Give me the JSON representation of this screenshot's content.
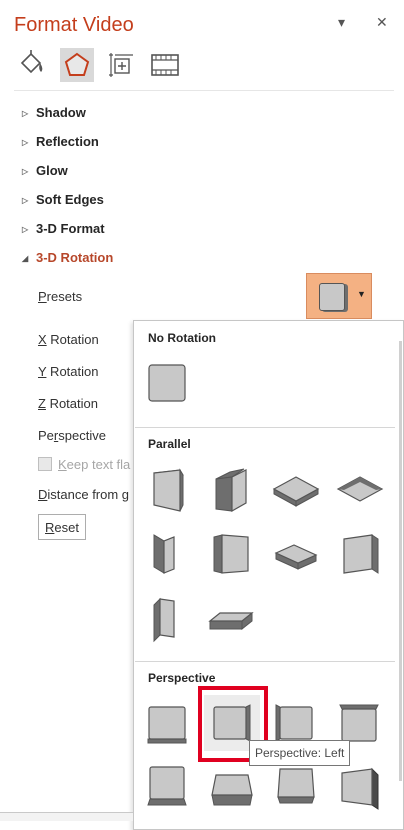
{
  "pane": {
    "title": "Format Video",
    "options_glyph": "▾",
    "close_glyph": "✕",
    "tabs": [
      {
        "icon": "paint-bucket-icon",
        "active": false
      },
      {
        "icon": "pentagon-effects-icon",
        "active": true
      },
      {
        "icon": "size-properties-icon",
        "active": false
      },
      {
        "icon": "video-filmstrip-icon",
        "active": false
      }
    ]
  },
  "sections": [
    {
      "label": "Shadow",
      "expanded": false
    },
    {
      "label": "Reflection",
      "expanded": false
    },
    {
      "label": "Glow",
      "expanded": false
    },
    {
      "label": "Soft Edges",
      "expanded": false
    },
    {
      "label": "3-D Format",
      "expanded": false
    },
    {
      "label": "3-D Rotation",
      "expanded": true
    }
  ],
  "rotation": {
    "presets_accel": "P",
    "presets_rest": "resets",
    "x_accel": "X",
    "x_rest": " Rotation",
    "y_accel": "Y",
    "y_rest": " Rotation",
    "z_accel": "Z",
    "z_rest": " Rotation",
    "perspective_pre": "Pe",
    "perspective_accel": "r",
    "perspective_post": "spective",
    "keep_text_accel": "K",
    "keep_text_rest": "eep text fla",
    "distance_accel": "D",
    "distance_rest": "istance from g",
    "reset_accel": "R",
    "reset_rest": "eset"
  },
  "gallery": {
    "no_rotation": "No Rotation",
    "parallel": "Parallel",
    "perspective": "Perspective",
    "hovered_tooltip": "Perspective: Left"
  },
  "colors": {
    "title": "#c43e1c",
    "expanded_section": "#b7472a",
    "preset_button": "#f4b183",
    "highlight_box": "#e00020",
    "shape_face": "#c8c8c8",
    "shape_side": "#6e6e6e"
  }
}
